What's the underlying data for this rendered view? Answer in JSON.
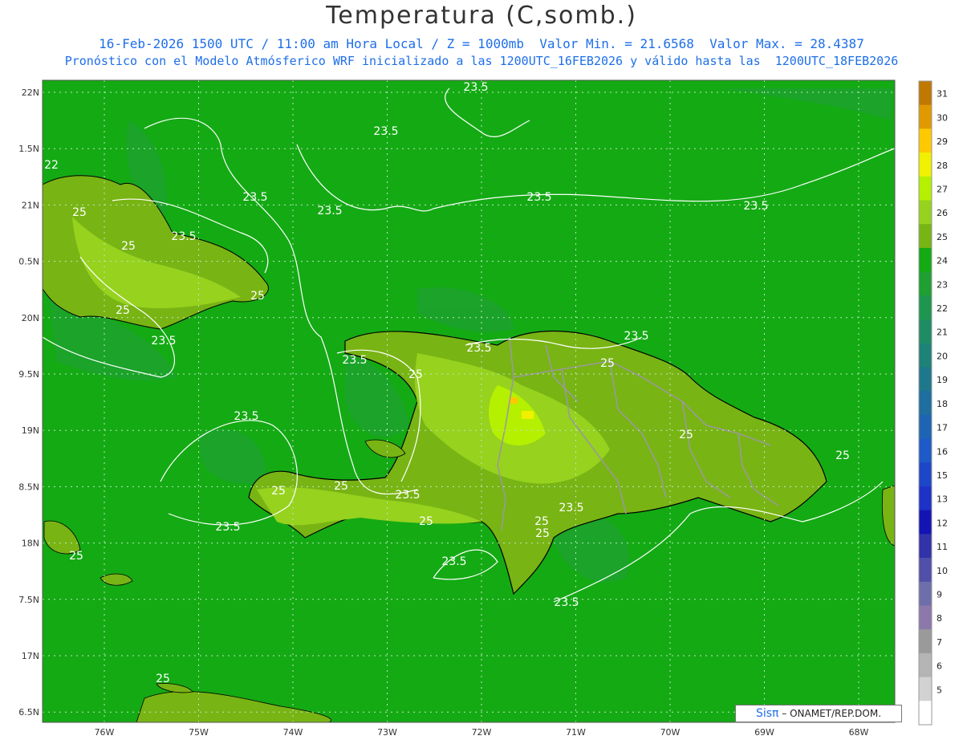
{
  "header": {
    "title": "Temperatura (C,somb.)",
    "line1": "16-Feb-2026 1500 UTC / 11:00 am Hora Local / Z = 1000mb  Valor Min. = 21.6568  Valor Max. = 28.4387",
    "line2": "Pronóstico con el Modelo Atmósferico WRF inicializado a las 1200UTC_16FEB2026 y válido hasta las  1200UTC_18FEB2026"
  },
  "axes": {
    "lat_labels": [
      "22N",
      "1.5N",
      "21N",
      "0.5N",
      "20N",
      "9.5N",
      "19N",
      "8.5N",
      "18N",
      "7.5N",
      "17N",
      "6.5N"
    ],
    "lon_labels": [
      "76W",
      "75W",
      "74W",
      "73W",
      "72W",
      "71W",
      "70W",
      "69W",
      "68W"
    ]
  },
  "colorbar": {
    "ticks": [
      "31",
      "30",
      "29",
      "28",
      "27",
      "26",
      "25",
      "24",
      "23",
      "22",
      "21",
      "20",
      "19",
      "18",
      "17",
      "16",
      "15",
      "13",
      "12",
      "11",
      "10",
      "9",
      "8",
      "7",
      "6",
      "5"
    ],
    "colors": [
      "#c07800",
      "#e09a00",
      "#ffc800",
      "#f0f000",
      "#b4f000",
      "#96d21e",
      "#78b414",
      "#14aa14",
      "#1ea032",
      "#1e9650",
      "#1e8c64",
      "#1e8278",
      "#1e788c",
      "#1e6ea0",
      "#1e64b4",
      "#1e5ac8",
      "#1e46c8",
      "#1e32c8",
      "#1414b4",
      "#3232aa",
      "#5050aa",
      "#6e6eaa",
      "#8c78aa",
      "#9a9a9a",
      "#b4b4b4",
      "#d2d2d2",
      "#ffffff"
    ]
  },
  "contour_labels": [
    {
      "text": "23.5"
    },
    {
      "text": "23.5"
    },
    {
      "text": "23.5"
    },
    {
      "text": "23.5"
    },
    {
      "text": "23.5"
    },
    {
      "text": "23.5"
    },
    {
      "text": "23.5"
    },
    {
      "text": "23.5"
    },
    {
      "text": "23.5"
    },
    {
      "text": "23.5"
    },
    {
      "text": "23.5"
    },
    {
      "text": "23.5"
    },
    {
      "text": "23.5"
    },
    {
      "text": "23.5"
    },
    {
      "text": "23.5"
    },
    {
      "text": "23.5"
    },
    {
      "text": "23.5"
    },
    {
      "text": "22"
    },
    {
      "text": "25"
    },
    {
      "text": "25"
    },
    {
      "text": "25"
    },
    {
      "text": "25"
    },
    {
      "text": "25"
    },
    {
      "text": "25"
    },
    {
      "text": "25"
    },
    {
      "text": "25"
    },
    {
      "text": "25"
    },
    {
      "text": "25"
    },
    {
      "text": "25"
    },
    {
      "text": "25"
    },
    {
      "text": "25"
    },
    {
      "text": "25"
    },
    {
      "text": "25"
    }
  ],
  "credit": {
    "brand": "Sisπ",
    "rest": " – ONAMET/REP.DOM."
  }
}
